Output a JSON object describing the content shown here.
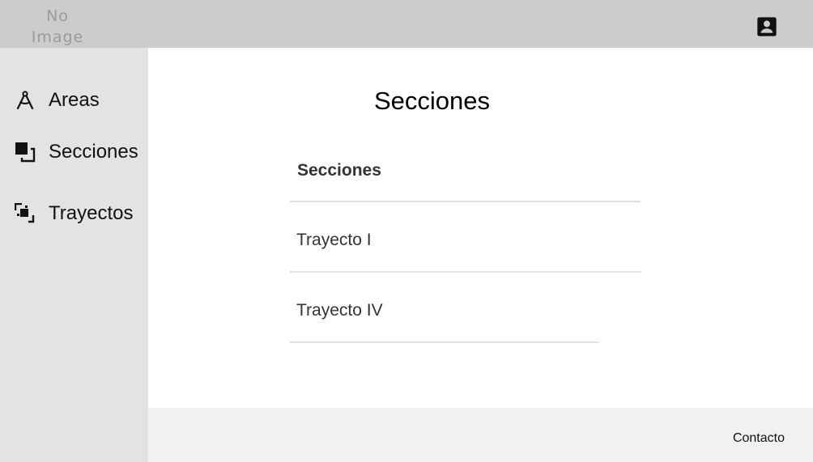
{
  "header": {
    "logo_alt": "No Image",
    "logo_line1": "No",
    "logo_line2": "Image",
    "account_icon": "account-box-icon"
  },
  "sidebar": {
    "items": [
      {
        "label": "Areas",
        "icon": "compass-drafting-icon"
      },
      {
        "label": "Secciones",
        "icon": "flip-to-front-icon"
      },
      {
        "label": "Trayectos",
        "icon": "select-all-icon"
      }
    ]
  },
  "main": {
    "title": "Secciones",
    "table": {
      "header": "Secciones",
      "rows": [
        "Trayecto I",
        "Trayecto IV"
      ]
    }
  },
  "footer": {
    "contact_label": "Contacto"
  },
  "colors": {
    "header_bg": "#cccccc",
    "sidebar_bg": "#e3e3e3",
    "footer_bg": "#f1f1f1",
    "text": "#111111"
  }
}
